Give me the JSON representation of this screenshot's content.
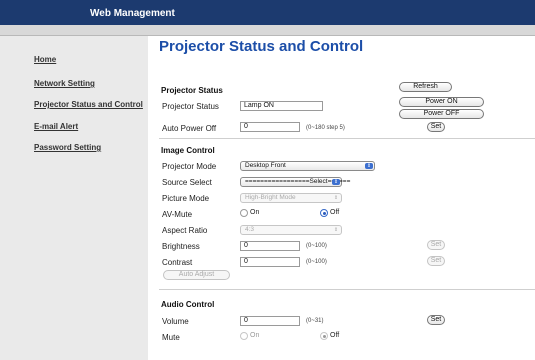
{
  "header": {
    "title": "Web Management"
  },
  "sidebar": {
    "items": [
      {
        "label": "Home"
      },
      {
        "label": "Network Setting"
      },
      {
        "label": "Projector Status and Control"
      },
      {
        "label": "E-mail Alert"
      },
      {
        "label": "Password Setting"
      }
    ]
  },
  "main": {
    "title": "Projector Status and Control",
    "projector_status": {
      "heading": "Projector Status",
      "refresh_label": "Refresh",
      "status_label": "Projector Status",
      "status_value": "Lamp ON",
      "power_on_label": "Power ON",
      "power_off_label": "Power OFF",
      "auto_power_off_label": "Auto Power Off",
      "auto_power_off_value": "0",
      "auto_power_off_hint": "(0~180 step 5)",
      "set_label": "Set"
    },
    "image_control": {
      "heading": "Image Control",
      "projector_mode_label": "Projector Mode",
      "projector_mode_value": "Desktop Front",
      "source_select_label": "Source Select",
      "source_select_value": "=================Select======",
      "picture_mode_label": "Picture Mode",
      "picture_mode_value": "High-Bright Mode",
      "av_mute_label": "AV-Mute",
      "av_mute_on_label": "On",
      "av_mute_off_label": "Off",
      "av_mute_selected": "Off",
      "aspect_ratio_label": "Aspect Ratio",
      "aspect_ratio_value": "4:3",
      "brightness_label": "Brightness",
      "brightness_value": "0",
      "brightness_hint": "(0~100)",
      "contrast_label": "Contrast",
      "contrast_value": "0",
      "contrast_hint": "(0~100)",
      "set_label": "Set",
      "auto_adjust_label": "Auto Adjust"
    },
    "audio_control": {
      "heading": "Audio Control",
      "volume_label": "Volume",
      "volume_value": "0",
      "volume_hint": "(0~31)",
      "set_label": "Set",
      "mute_label": "Mute",
      "mute_on_label": "On",
      "mute_off_label": "Off",
      "mute_selected": "Off"
    }
  },
  "colors": {
    "header_bg": "#1c3a6f",
    "title": "#1c4ea8",
    "sidebar_bg": "#eaeaea",
    "accent": "#3c6fcf"
  },
  "icons": {
    "select_arrow": "updown-arrow-icon"
  }
}
